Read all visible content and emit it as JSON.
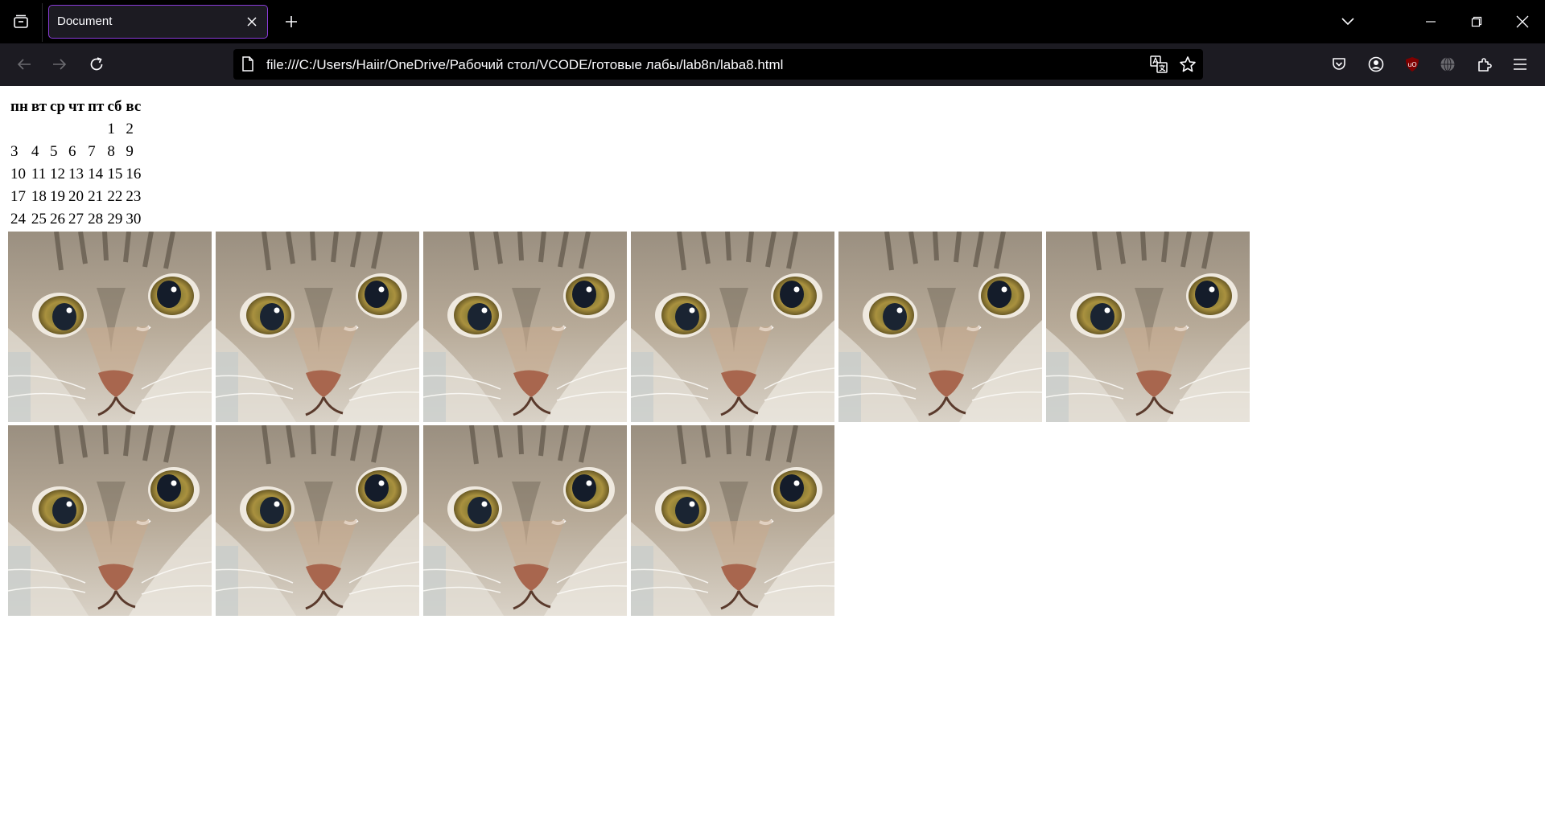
{
  "browser": {
    "tab": {
      "title": "Document"
    },
    "url": "file:///C:/Users/Haiir/OneDrive/Рабочий стол/VCODE/готовые лабы/lab8n/laba8.html",
    "accent_color": "#8a3bd8",
    "icons": [
      "tab-list-icon",
      "close-icon",
      "plus-icon",
      "chevron-down-icon",
      "minimize-icon",
      "restore-icon",
      "close-window-icon",
      "back-arrow-icon",
      "forward-arrow-icon",
      "reload-icon",
      "page-icon",
      "translate-icon",
      "star-icon",
      "pocket-icon",
      "account-icon",
      "ublock-icon",
      "globe-icon",
      "extensions-icon",
      "menu-icon"
    ]
  },
  "calendar": {
    "weekdays": [
      "пн",
      "вт",
      "ср",
      "чт",
      "пт",
      "сб",
      "вс"
    ],
    "weeks": [
      [
        "",
        "",
        "",
        "",
        "",
        "1",
        "2"
      ],
      [
        "3",
        "4",
        "5",
        "6",
        "7",
        "8",
        "9"
      ],
      [
        "10",
        "11",
        "12",
        "13",
        "14",
        "15",
        "16"
      ],
      [
        "17",
        "18",
        "19",
        "20",
        "21",
        "22",
        "23"
      ],
      [
        "24",
        "25",
        "26",
        "27",
        "28",
        "29",
        "30"
      ]
    ]
  },
  "gallery": {
    "image_count": 10,
    "image_subject": "cat-face"
  }
}
